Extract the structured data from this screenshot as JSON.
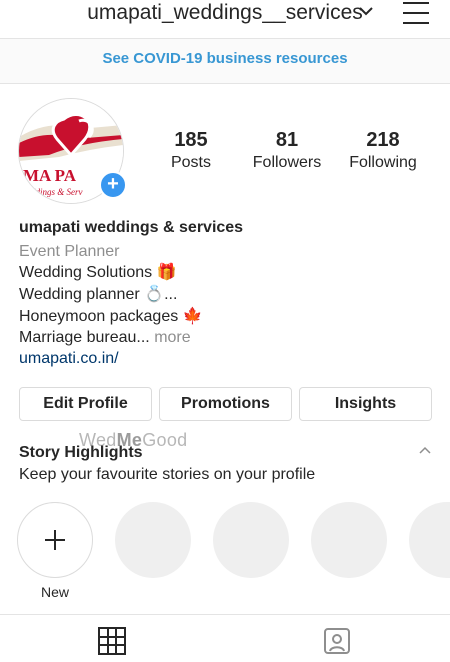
{
  "header": {
    "username": "umapati_weddings__services",
    "dropdown_icon": "chevron-down-icon",
    "menu_icon": "hamburger-menu-icon"
  },
  "banner": {
    "covid_link": "See COVID-19 business resources"
  },
  "profile": {
    "avatar_text": "MA PA",
    "avatar_subtext": "eddings & Serv",
    "stats": [
      {
        "value": "185",
        "label": "Posts"
      },
      {
        "value": "81",
        "label": "Followers"
      },
      {
        "value": "218",
        "label": "Following"
      }
    ],
    "name": "umapati weddings & services",
    "category": "Event Planner",
    "bio": [
      {
        "text": "Wedding Solutions",
        "emoji": "🎁"
      },
      {
        "text": "Wedding planner",
        "emoji": "💍",
        "suffix": "..."
      },
      {
        "text": "Honeymoon packages",
        "emoji": "🍁"
      }
    ],
    "bio_last": "Marriage bureau...",
    "more_label": "more",
    "website": "umapati.co.in/"
  },
  "actions": {
    "edit_profile": "Edit Profile",
    "promotions": "Promotions",
    "insights": "Insights"
  },
  "watermark": {
    "part1": "Wed",
    "part2": "Me",
    "part3": "Good"
  },
  "highlights": {
    "title": "Story Highlights",
    "subtitle": "Keep your favourite stories on your profile",
    "new_label": "New",
    "placeholder_count": 4
  },
  "tabs": [
    {
      "icon": "grid-icon"
    },
    {
      "icon": "tagged-person-icon"
    }
  ],
  "colors": {
    "link_blue": "#3897d3",
    "badge_blue": "#3897f0",
    "avatar_red": "#c8102e"
  }
}
